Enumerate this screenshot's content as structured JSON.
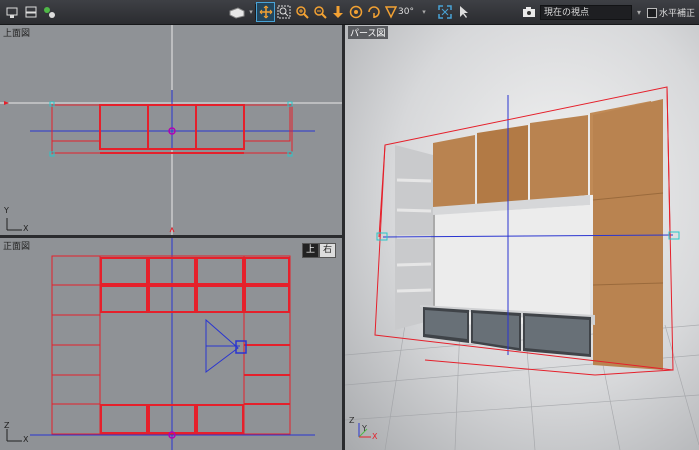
{
  "toolbar": {
    "left_tools": [
      "camera-icon",
      "camera-settings-icon",
      "render-icon"
    ],
    "tools": [
      "shape-icon",
      "move-icon",
      "zoom-region-icon",
      "zoom-in-icon",
      "zoom-out-icon",
      "walk-icon",
      "orbit-icon",
      "turn-icon",
      "angle-icon",
      "fit-icon",
      "select-icon"
    ],
    "angle_value": "30°",
    "view_select": "現在の視点",
    "assist_label": "水平補正"
  },
  "panes": {
    "top": {
      "label": "上面図",
      "axis_y": "Y",
      "axis_x": "X"
    },
    "front": {
      "label": "正面図",
      "axis_z": "Z",
      "axis_x": "X",
      "btn_top": "上",
      "btn_side": "右"
    },
    "persp": {
      "label": "パース図",
      "axis_z": "Z",
      "axis_y": "Y",
      "axis_x": "X"
    }
  },
  "colors": {
    "accent": "#e5202b",
    "bg_view": "#8f9296",
    "wood": "#b07a45"
  }
}
